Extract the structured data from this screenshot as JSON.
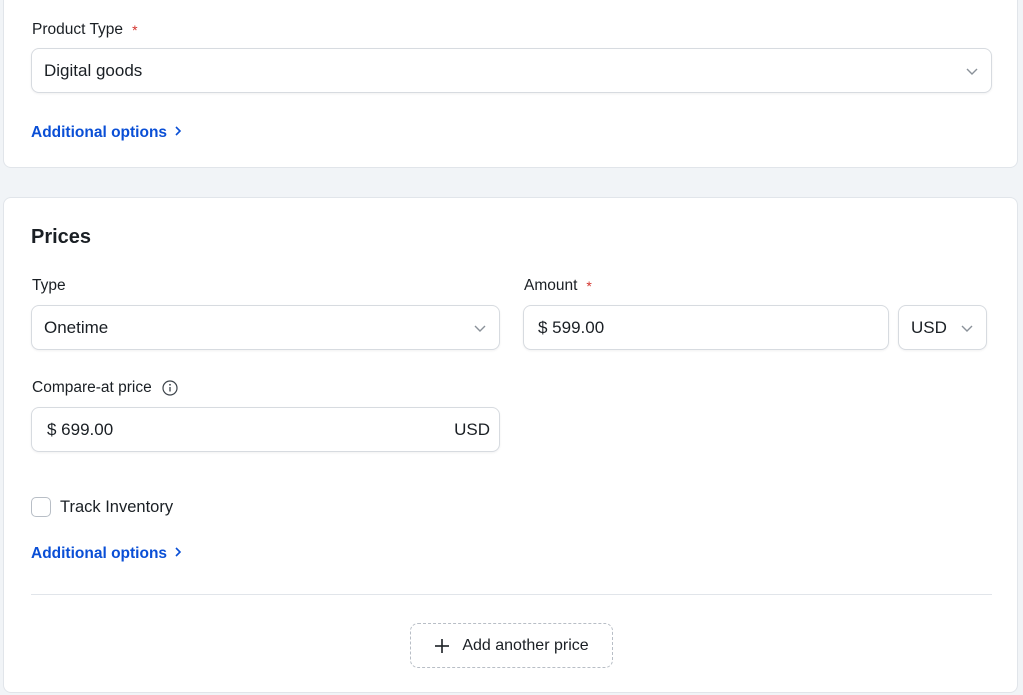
{
  "product": {
    "type_label": "Product Type",
    "type_required": "*",
    "type_value": "Digital goods",
    "additional_options": "Additional options"
  },
  "prices": {
    "title": "Prices",
    "type_label": "Type",
    "type_value": "Onetime",
    "amount_label": "Amount",
    "amount_required": "*",
    "amount_value": "$ 599.00",
    "currency_value": "USD",
    "compare_label": "Compare-at price",
    "compare_value": "$ 699.00",
    "compare_currency": "USD",
    "track_inventory_label": "Track Inventory",
    "additional_options": "Additional options",
    "add_price_label": "Add another price"
  },
  "icons": {
    "select_chevron": "chevron-down-icon",
    "link_chevron": "chevron-right-icon",
    "info": "info-icon",
    "add": "plus-icon"
  },
  "colors": {
    "link": "#0a4fd6",
    "required": "#d3322c",
    "background": "#f1f4f7"
  }
}
